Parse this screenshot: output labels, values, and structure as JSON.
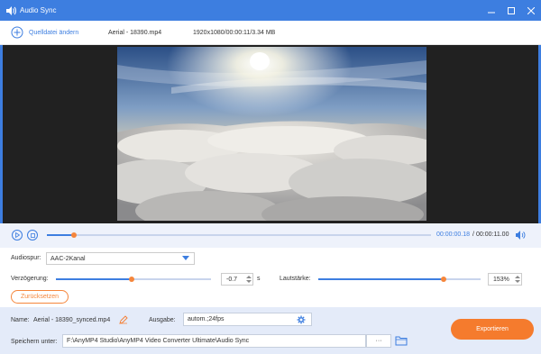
{
  "window": {
    "title": "Audio Sync"
  },
  "toolbar": {
    "source_label": "Quelldatei ändern",
    "file_name": "Aerial - 18390.mp4",
    "file_meta": "1920x1080/00:00:11/3.34 MB"
  },
  "player": {
    "current_time": "00:00:00.18",
    "separator": "/",
    "total_time": "00:00:11.00",
    "progress_fraction": 0.07
  },
  "settings": {
    "audio_track_label": "Audiospur:",
    "audio_track_value": "AAC-2Kanal",
    "delay_label": "Verzögerung:",
    "delay_value": "-0.7",
    "delay_unit": "s",
    "delay_fraction": 0.49,
    "volume_label": "Lautstärke:",
    "volume_value": "153%",
    "volume_fraction": 0.77,
    "reset_label": "Zurücksetzen"
  },
  "output": {
    "name_label": "Name:",
    "name_value": "Aerial - 18390_synced.mp4",
    "format_label": "Ausgabe:",
    "format_value": "autom.;24fps",
    "save_label": "Speichern unter:",
    "save_path": "F:\\AnyMP4 Studio\\AnyMP4 Video Converter Ultimate\\Audio Sync",
    "browse_label": "···",
    "export_label": "Exportieren"
  },
  "colors": {
    "accent": "#3d7ee0",
    "orange": "#f57b2d",
    "titlebar": "#3d7ee0"
  }
}
